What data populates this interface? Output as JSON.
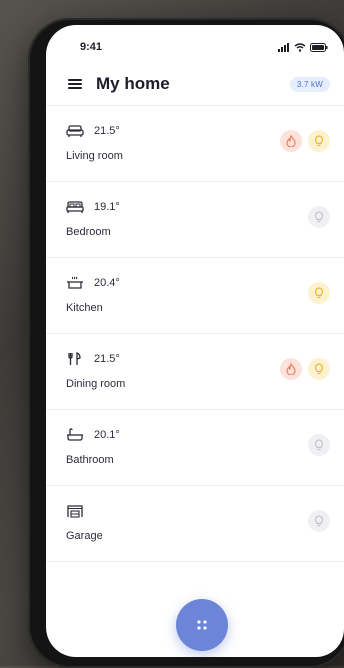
{
  "status_bar": {
    "time": "9:41"
  },
  "header": {
    "title": "My home",
    "power": "3.7 kW"
  },
  "rooms": [
    {
      "name": "Living room",
      "temp": "21.5°",
      "icon": "sofa-icon",
      "heating": true,
      "light": "on"
    },
    {
      "name": "Bedroom",
      "temp": "19.1°",
      "icon": "bed-icon",
      "heating": false,
      "light": "off"
    },
    {
      "name": "Kitchen",
      "temp": "20.4°",
      "icon": "cooking-pot-icon",
      "heating": false,
      "light": "on"
    },
    {
      "name": "Dining room",
      "temp": "21.5°",
      "icon": "fork-knife-icon",
      "heating": true,
      "light": "on"
    },
    {
      "name": "Bathroom",
      "temp": "20.1°",
      "icon": "bathtub-icon",
      "heating": false,
      "light": "off"
    },
    {
      "name": "Garage",
      "temp": "",
      "icon": "garage-icon",
      "heating": false,
      "light": "off"
    }
  ],
  "colors": {
    "accent": "#6c85d9",
    "heat": "#e8845f",
    "light_on": "#e9b934",
    "light_off": "#c4c4cc"
  }
}
